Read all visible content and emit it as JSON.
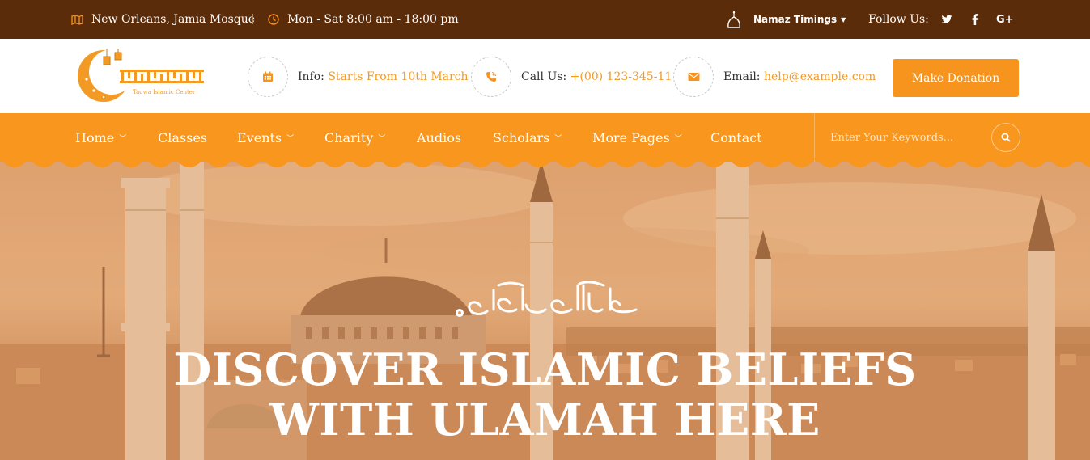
{
  "topbar": {
    "location": "New Orleans, Jamia Mosque",
    "hours": "Mon - Sat 8:00 am - 18:00 pm",
    "namaz": "Namaz Timings",
    "follow": "Follow Us:",
    "social": [
      "twitter-icon",
      "facebook-icon",
      "google-plus-icon"
    ]
  },
  "logo": {
    "name": "Taqwa Islamic Center"
  },
  "header": {
    "info_label": "Info:",
    "info_value": "Starts From 10th March",
    "call_label": "Call Us:",
    "call_value": "+(00) 123-345-11",
    "email_label": "Email:",
    "email_value": "help@example.com",
    "donate": "Make Donation"
  },
  "nav": {
    "items": [
      {
        "label": "Home",
        "dropdown": true
      },
      {
        "label": "Classes",
        "dropdown": false
      },
      {
        "label": "Events",
        "dropdown": true
      },
      {
        "label": "Charity",
        "dropdown": true
      },
      {
        "label": "Audios",
        "dropdown": false
      },
      {
        "label": "Scholars",
        "dropdown": true
      },
      {
        "label": "More Pages",
        "dropdown": true
      },
      {
        "label": "Contact",
        "dropdown": false
      }
    ],
    "search_placeholder": "Enter Your Keywords..."
  },
  "hero": {
    "title_line1": "DISCOVER ISLAMIC BELIEFS",
    "title_line2": "WITH ULAMAH HERE"
  },
  "colors": {
    "topbar": "#5b2c0a",
    "accent": "#f7941d",
    "nav": "#f8961e"
  }
}
